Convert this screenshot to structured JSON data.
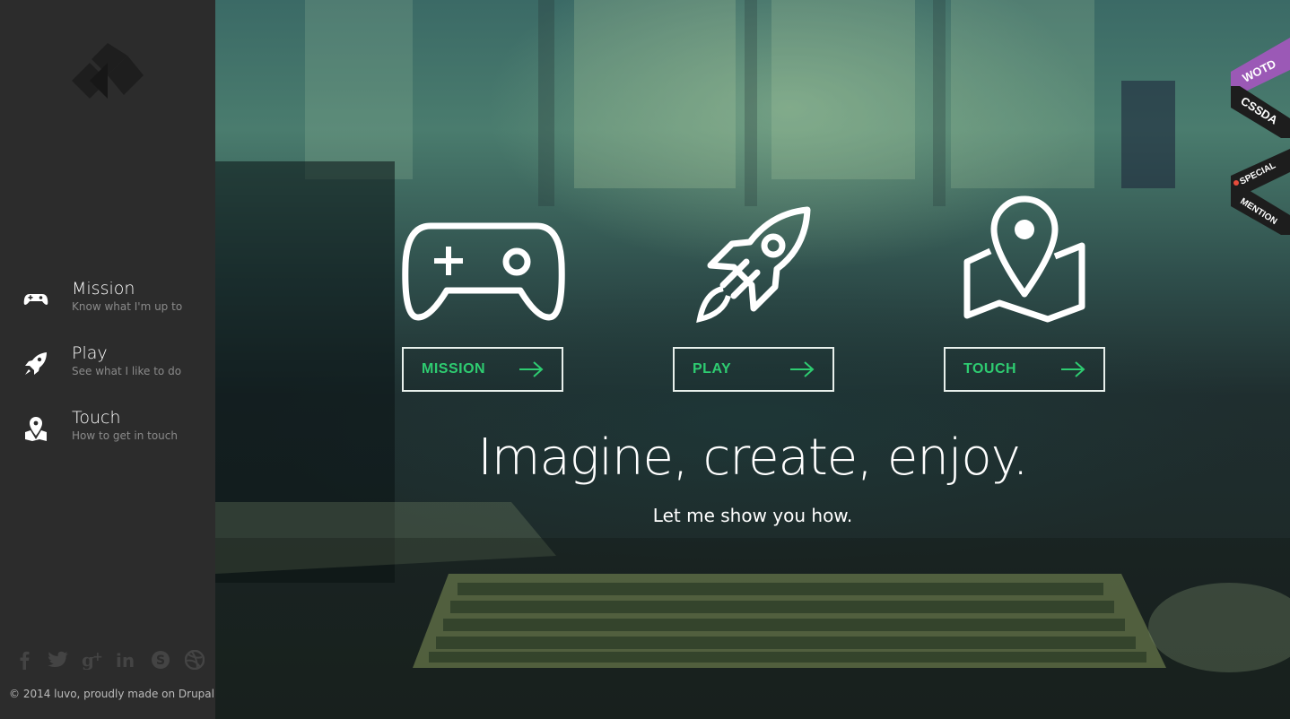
{
  "sidebar": {
    "logo_icon": "diamond-logo-icon",
    "items": [
      {
        "title": "Mission",
        "subtitle": "Know what I'm up to",
        "icon": "gamepad-icon"
      },
      {
        "title": "Play",
        "subtitle": "See what I like to do",
        "icon": "rocket-icon"
      },
      {
        "title": "Touch",
        "subtitle": "How to get in touch",
        "icon": "map-pin-icon"
      }
    ],
    "social": [
      "facebook-icon",
      "twitter-icon",
      "google-plus-icon",
      "linkedin-icon",
      "skype-icon",
      "dribbble-icon"
    ],
    "copyright": "© 2014 luvo, proudly made on Drupal"
  },
  "hero": {
    "cards": [
      {
        "label": "MISSION",
        "icon": "gamepad-icon"
      },
      {
        "label": "PLAY",
        "icon": "rocket-icon"
      },
      {
        "label": "TOUCH",
        "icon": "map-pin-icon"
      }
    ],
    "headline": "Imagine, create, enjoy.",
    "subline": "Let me show you how."
  },
  "ribbons": {
    "wotd": "WOTD",
    "cssda": "CSSDA",
    "special": "SPECIAL",
    "mention": "MENTION"
  },
  "colors": {
    "accent": "#2ecc71",
    "sidebar_bg": "#2c2c2c",
    "ribbon_purple": "#9b59b6"
  }
}
